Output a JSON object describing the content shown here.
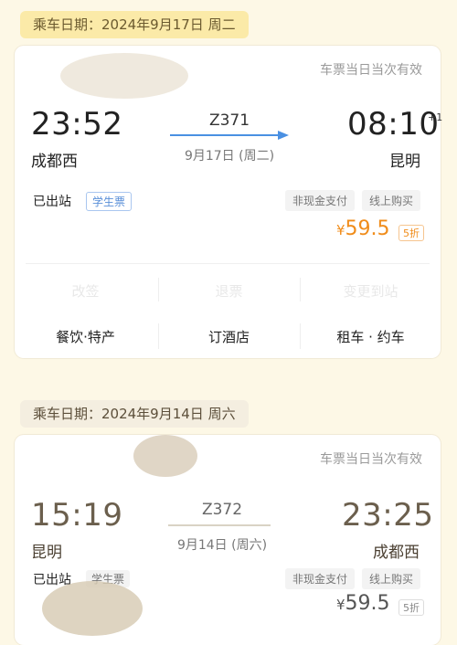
{
  "trips": [
    {
      "date_label": "乘车日期：2024年9月17日 周二",
      "validity": "车票当日当次有效",
      "depart_time": "23:52",
      "depart_station": "成都西",
      "train_no": "Z371",
      "sub_date": "9月17日 (周二)",
      "arrive_time": "08:10",
      "day_offset": "+1",
      "arrive_station": "昆明",
      "status": "已出站",
      "badge": "学生票",
      "tags": [
        "非现金支付",
        "线上购买"
      ],
      "price_symbol": "¥",
      "price": "59.5",
      "discount": "5折",
      "faded_actions": [
        "改签",
        "退票",
        "变更到站"
      ],
      "actions": [
        "餐饮·特产",
        "订酒店",
        "租车 · 约车"
      ]
    },
    {
      "date_label": "乘车日期：2024年9月14日 周六",
      "validity": "车票当日当次有效",
      "depart_time": "15:19",
      "depart_station": "昆明",
      "train_no": "Z372",
      "sub_date": "9月14日 (周六)",
      "arrive_time": "23:25",
      "arrive_station": "成都西",
      "status": "已出站",
      "badge": "学生票",
      "tags": [
        "非现金支付",
        "线上购买"
      ],
      "price_symbol": "¥",
      "price": "59.5",
      "discount": "5折"
    }
  ],
  "colors": {
    "accent_orange": "#f08c1a",
    "arrow_blue": "#4a90e2",
    "background": "#fdf8e6",
    "date_pill_1": "#fbeaa8",
    "date_pill_2": "#f4eee0"
  }
}
